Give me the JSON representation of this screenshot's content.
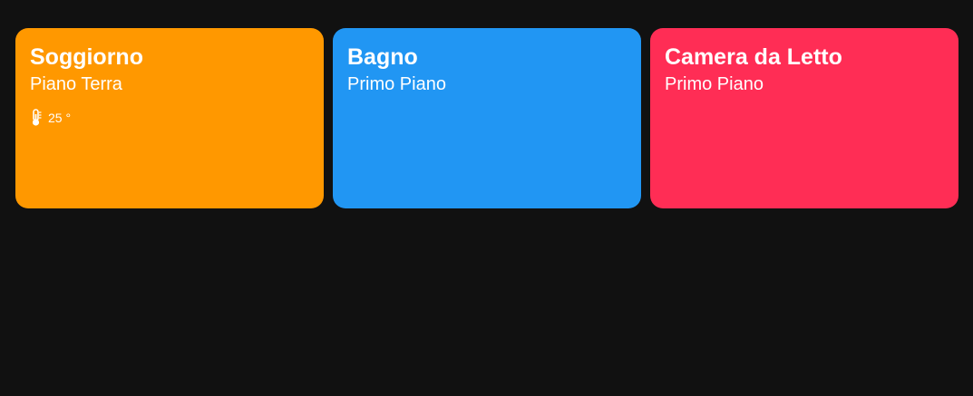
{
  "colors": {
    "background": "#111111",
    "card_orange": "#FF9800",
    "card_blue": "#2196F3",
    "card_pink": "#FF2D55"
  },
  "rooms": [
    {
      "title": "Soggiorno",
      "floor": "Piano Terra",
      "temperature": "25 °",
      "icon": "thermometer-icon",
      "color": "#FF9800"
    },
    {
      "title": "Bagno",
      "floor": "Primo Piano",
      "color": "#2196F3"
    },
    {
      "title": "Camera da Letto",
      "floor": "Primo Piano",
      "color": "#FF2D55"
    }
  ]
}
